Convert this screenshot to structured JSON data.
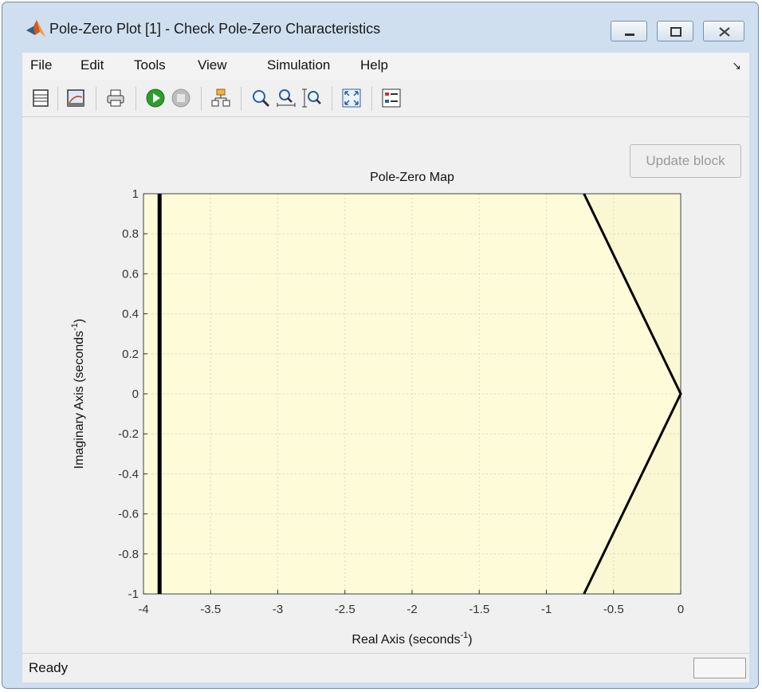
{
  "window": {
    "title": "Pole-Zero Plot [1] - Check Pole-Zero Characteristics"
  },
  "menu": {
    "items": [
      "File",
      "Edit",
      "Tools",
      "View",
      "Simulation",
      "Help"
    ],
    "more_glyph": "↘"
  },
  "toolbar": {
    "icons": [
      "show-plot-icon",
      "figure-icon",
      "print-icon",
      "run-icon",
      "stop-icon",
      "block-link-icon",
      "zoom-in-icon",
      "zoom-x-icon",
      "zoom-y-icon",
      "fit-view-icon",
      "legend-icon"
    ]
  },
  "update_block_label": "Update block",
  "status": {
    "text": "Ready"
  },
  "chart_data": {
    "type": "line",
    "title": "Pole-Zero Map",
    "xlabel": "Real Axis (seconds",
    "xlabel_sup": "-1",
    "xlabel_close": ")",
    "ylabel": "Imaginary Axis (seconds",
    "ylabel_sup": "-1",
    "ylabel_close": ")",
    "xlim": [
      -4,
      0
    ],
    "ylim": [
      -1,
      1
    ],
    "x_ticks": [
      "-4",
      "-3.5",
      "-3",
      "-2.5",
      "-2",
      "-1.5",
      "-1",
      "-0.5",
      "0"
    ],
    "x_tick_values": [
      -4,
      -3.5,
      -3,
      -2.5,
      -2,
      -1.5,
      -1,
      -0.5,
      0
    ],
    "y_ticks": [
      "1",
      "0.8",
      "0.6",
      "0.4",
      "0.2",
      "0",
      "-0.2",
      "-0.4",
      "-0.6",
      "-0.8",
      "-1"
    ],
    "y_tick_values": [
      1,
      0.8,
      0.6,
      0.4,
      0.2,
      0,
      -0.2,
      -0.4,
      -0.6,
      -0.8,
      -1
    ],
    "grid": true,
    "region_fill_color": "#fdfbd8",
    "region_fill_color_alt": "#faf8d2",
    "bound_color": "#000000",
    "bounds": [
      {
        "kind": "settling-time-bound",
        "points": [
          [
            -3.88,
            1
          ],
          [
            -3.88,
            -1
          ]
        ]
      },
      {
        "kind": "damping-bound",
        "points": [
          [
            -0.72,
            1
          ],
          [
            0,
            0
          ],
          [
            -0.72,
            -1
          ]
        ]
      }
    ]
  },
  "colors": {
    "window_frame": "#cfdff0",
    "run_green": "#2e9d2e"
  }
}
